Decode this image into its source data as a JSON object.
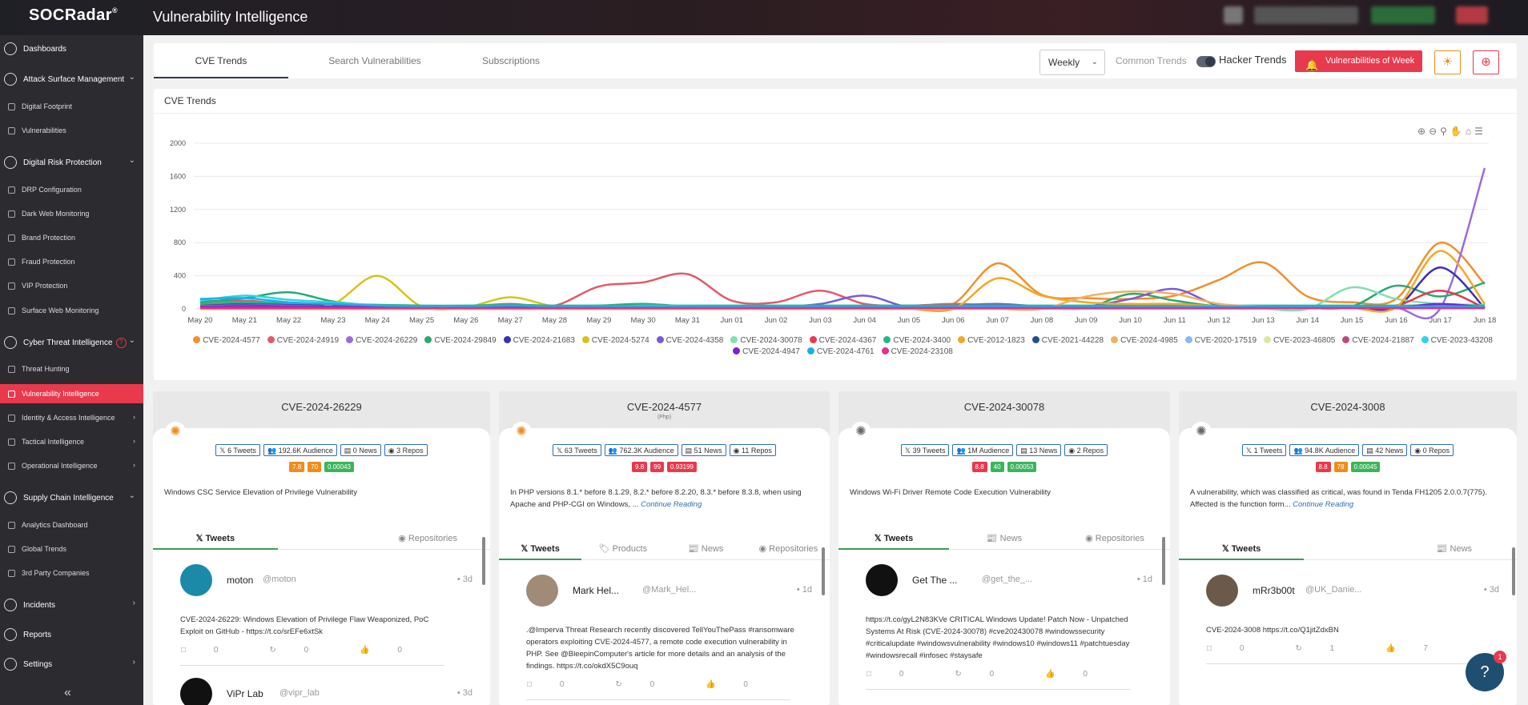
{
  "app": {
    "logo": "SOCRadar",
    "logo_mark": "®",
    "title": "Vulnerability Intelligence"
  },
  "sidebar": {
    "sections": [
      {
        "label": "Dashboards"
      },
      {
        "label": "Attack Surface Management"
      },
      {
        "label": "Digital Risk Protection"
      },
      {
        "label": "Cyber Threat Intelligence"
      },
      {
        "label": "Supply Chain Intelligence"
      },
      {
        "label": "Incidents"
      },
      {
        "label": "Reports"
      },
      {
        "label": "Settings"
      }
    ],
    "items": [
      {
        "label": "Digital Footprint"
      },
      {
        "label": "Vulnerabilities"
      },
      {
        "label": "DRP Configuration"
      },
      {
        "label": "Dark Web Monitoring"
      },
      {
        "label": "Brand Protection"
      },
      {
        "label": "Fraud Protection"
      },
      {
        "label": "VIP Protection"
      },
      {
        "label": "Surface Web Monitoring"
      },
      {
        "label": "Threat Hunting"
      },
      {
        "label": "Vulnerability Intelligence"
      },
      {
        "label": "Identity & Access Intelligence"
      },
      {
        "label": "Tactical Intelligence"
      },
      {
        "label": "Operational Intelligence"
      },
      {
        "label": "Analytics Dashboard"
      },
      {
        "label": "Global Trends"
      },
      {
        "label": "3rd Party Companies"
      }
    ],
    "cti_badge": "?"
  },
  "tabs": [
    {
      "label": "CVE Trends"
    },
    {
      "label": "Search Vulnerabilities"
    },
    {
      "label": "Subscriptions"
    }
  ],
  "controls": {
    "period": "Weekly",
    "common_trends": "Common Trends",
    "hacker_trends": "Hacker Trends",
    "vuln_week": "Vulnerabilities of Week"
  },
  "chart_data": {
    "type": "line",
    "title": "CVE Trends",
    "x": [
      "May 20",
      "May 21",
      "May 22",
      "May 23",
      "May 24",
      "May 25",
      "May 26",
      "May 27",
      "May 28",
      "May 29",
      "May 30",
      "May 31",
      "Jun 01",
      "Jun 02",
      "Jun 03",
      "Jun 04",
      "Jun 05",
      "Jun 06",
      "Jun 07",
      "Jun 08",
      "Jun 09",
      "Jun 10",
      "Jun 11",
      "Jun 12",
      "Jun 13",
      "Jun 14",
      "Jun 15",
      "Jun 16",
      "Jun 17",
      "Jun 18"
    ],
    "ylim": [
      0,
      2000
    ],
    "yticks": [
      0,
      400,
      800,
      1200,
      1600,
      2000
    ],
    "grid": true,
    "legend": "bottom",
    "series": [
      {
        "name": "CVE-2024-4577",
        "color": "#f28e2b",
        "values": [
          60,
          90,
          40,
          30,
          20,
          10,
          10,
          20,
          10,
          10,
          30,
          20,
          30,
          20,
          10,
          20,
          10,
          60,
          550,
          170,
          130,
          120,
          160,
          350,
          560,
          150,
          80,
          120,
          800,
          300
        ]
      },
      {
        "name": "CVE-2024-24919",
        "color": "#e15a6b",
        "values": [
          90,
          100,
          60,
          50,
          30,
          20,
          30,
          60,
          40,
          270,
          320,
          420,
          100,
          80,
          220,
          60,
          40,
          60,
          40,
          20,
          10,
          30,
          60,
          30,
          10,
          10,
          10,
          10,
          10,
          10
        ]
      },
      {
        "name": "CVE-2024-26229",
        "color": "#9b6be0",
        "values": [
          20,
          20,
          20,
          20,
          10,
          10,
          10,
          10,
          10,
          10,
          10,
          10,
          10,
          10,
          10,
          10,
          10,
          10,
          10,
          10,
          10,
          10,
          10,
          10,
          10,
          10,
          10,
          10,
          10,
          1700
        ]
      },
      {
        "name": "CVE-2024-29849",
        "color": "#2aa876",
        "values": [
          80,
          130,
          200,
          90,
          40,
          20,
          30,
          50,
          30,
          40,
          60,
          30,
          20,
          20,
          10,
          20,
          10,
          20,
          20,
          10,
          10,
          180,
          100,
          30,
          20,
          10,
          30,
          280,
          150,
          320
        ]
      },
      {
        "name": "CVE-2024-21683",
        "color": "#3b2fb5",
        "values": [
          40,
          60,
          50,
          40,
          30,
          20,
          20,
          30,
          20,
          20,
          20,
          20,
          20,
          20,
          20,
          20,
          20,
          20,
          20,
          20,
          20,
          20,
          20,
          20,
          20,
          20,
          20,
          20,
          500,
          10
        ]
      },
      {
        "name": "CVE-2024-5274",
        "color": "#d6c318",
        "values": [
          30,
          40,
          30,
          60,
          400,
          30,
          20,
          140,
          30,
          20,
          20,
          20,
          20,
          20,
          20,
          20,
          20,
          20,
          20,
          20,
          20,
          20,
          20,
          20,
          20,
          20,
          20,
          20,
          20,
          20
        ]
      },
      {
        "name": "CVE-2024-4358",
        "color": "#7a5bd6",
        "values": [
          30,
          50,
          40,
          30,
          20,
          20,
          20,
          20,
          20,
          20,
          20,
          20,
          20,
          20,
          60,
          160,
          20,
          40,
          60,
          30,
          30,
          120,
          240,
          40,
          30,
          20,
          20,
          20,
          20,
          20
        ]
      },
      {
        "name": "CVE-2024-30078",
        "color": "#7fe0b0",
        "values": [
          0,
          0,
          0,
          0,
          0,
          0,
          0,
          0,
          0,
          0,
          0,
          0,
          0,
          0,
          0,
          0,
          0,
          0,
          0,
          0,
          0,
          0,
          0,
          0,
          0,
          0,
          260,
          120,
          60,
          50
        ]
      },
      {
        "name": "CVE-2024-4367",
        "color": "#e8394d",
        "values": [
          20,
          20,
          20,
          20,
          20,
          20,
          20,
          20,
          20,
          20,
          20,
          20,
          20,
          20,
          20,
          20,
          20,
          20,
          20,
          20,
          20,
          20,
          20,
          20,
          20,
          20,
          20,
          40,
          220,
          10
        ]
      },
      {
        "name": "CVE-2024-3400",
        "color": "#1fb889",
        "values": [
          60,
          80,
          70,
          60,
          50,
          40,
          40,
          50,
          40,
          40,
          40,
          40,
          40,
          40,
          40,
          40,
          40,
          40,
          40,
          40,
          40,
          40,
          40,
          40,
          40,
          40,
          40,
          40,
          40,
          40
        ]
      },
      {
        "name": "CVE-2012-1823",
        "color": "#f5a623",
        "values": [
          0,
          0,
          0,
          0,
          0,
          0,
          0,
          0,
          0,
          0,
          0,
          0,
          0,
          0,
          0,
          0,
          0,
          0,
          370,
          160,
          80,
          60,
          60,
          30,
          20,
          10,
          10,
          20,
          700,
          60
        ]
      },
      {
        "name": "CVE-2021-44228",
        "color": "#1d4f91",
        "values": [
          30,
          40,
          30,
          30,
          20,
          20,
          20,
          20,
          20,
          20,
          20,
          20,
          20,
          20,
          20,
          20,
          20,
          20,
          20,
          20,
          20,
          20,
          20,
          20,
          20,
          20,
          20,
          20,
          20,
          20
        ]
      },
      {
        "name": "CVE-2024-4985",
        "color": "#f0b063",
        "values": [
          0,
          0,
          0,
          0,
          0,
          0,
          0,
          0,
          0,
          0,
          0,
          0,
          0,
          0,
          0,
          0,
          0,
          0,
          0,
          0,
          150,
          210,
          180,
          60,
          30,
          20,
          10,
          10,
          10,
          10
        ]
      },
      {
        "name": "CVE-2020-17519",
        "color": "#8ab8f0",
        "values": [
          20,
          30,
          20,
          20,
          20,
          20,
          20,
          20,
          20,
          20,
          20,
          20,
          20,
          20,
          20,
          20,
          20,
          20,
          20,
          20,
          20,
          20,
          20,
          20,
          20,
          20,
          20,
          20,
          20,
          20
        ]
      },
      {
        "name": "CVE-2023-46805",
        "color": "#d9e8a0",
        "values": [
          20,
          20,
          20,
          20,
          20,
          20,
          20,
          20,
          20,
          20,
          20,
          20,
          20,
          20,
          20,
          20,
          20,
          20,
          20,
          20,
          20,
          20,
          20,
          20,
          20,
          20,
          20,
          20,
          20,
          20
        ]
      },
      {
        "name": "CVE-2024-21887",
        "color": "#c2477f",
        "values": [
          40,
          30,
          30,
          30,
          20,
          20,
          20,
          20,
          20,
          20,
          20,
          20,
          20,
          20,
          20,
          20,
          20,
          20,
          20,
          20,
          20,
          20,
          20,
          20,
          20,
          20,
          20,
          20,
          20,
          20
        ]
      },
      {
        "name": "CVE-2023-43208",
        "color": "#2ed3e6",
        "values": [
          100,
          160,
          110,
          80,
          40,
          20,
          20,
          30,
          20,
          20,
          40,
          30,
          20,
          20,
          20,
          20,
          20,
          20,
          20,
          20,
          20,
          20,
          20,
          20,
          20,
          20,
          20,
          20,
          20,
          20
        ]
      },
      {
        "name": "CVE-2024-4947",
        "color": "#7b22d6",
        "values": [
          20,
          20,
          20,
          20,
          20,
          20,
          20,
          20,
          20,
          20,
          20,
          20,
          20,
          20,
          20,
          20,
          20,
          20,
          20,
          20,
          20,
          20,
          20,
          20,
          20,
          20,
          20,
          20,
          60,
          20
        ]
      },
      {
        "name": "CVE-2024-4761",
        "color": "#1ab0e8",
        "values": [
          120,
          130,
          80,
          60,
          40,
          30,
          30,
          40,
          30,
          30,
          30,
          30,
          30,
          30,
          30,
          30,
          30,
          30,
          30,
          30,
          30,
          30,
          30,
          30,
          30,
          30,
          30,
          30,
          30,
          30
        ]
      },
      {
        "name": "CVE-2024-23108",
        "color": "#e82d8a",
        "values": [
          10,
          10,
          10,
          10,
          10,
          10,
          10,
          10,
          10,
          10,
          10,
          10,
          10,
          10,
          10,
          10,
          10,
          10,
          10,
          10,
          10,
          10,
          10,
          10,
          10,
          10,
          10,
          10,
          10,
          10
        ]
      }
    ]
  },
  "cards": [
    {
      "cve": "CVE-2024-26229",
      "sub": "",
      "icon": "bug-orange-icon",
      "stats": [
        "6 Tweets",
        "192.6K Audience",
        "0 News",
        "3 Repos"
      ],
      "scores": [
        {
          "v": "7.8",
          "c": "#f08c1a"
        },
        {
          "v": "70",
          "c": "#f08c1a"
        },
        {
          "v": "0.00043",
          "c": "#3bb55a"
        }
      ],
      "desc": "Windows CSC Service Elevation of Privilege Vulnerability",
      "more": "",
      "tabs": [
        "Tweets",
        "Repositories"
      ],
      "tweets": [
        {
          "name": "moton",
          "handle": "@moton",
          "time": "3d",
          "text": "CVE-2024-26229: Windows Elevation of Privilege Flaw Weaponized, PoC Exploit on GitHub - https://t.co/srEFe6xtSk",
          "replies": "0",
          "retweets": "0",
          "likes": "0",
          "avatar": "#1a8aa8"
        },
        {
          "name": "ViPr Lab",
          "handle": "@vipr_lab",
          "time": "3d",
          "text": "",
          "avatar": "#111"
        }
      ]
    },
    {
      "cve": "CVE-2024-4577",
      "sub": "(Php)",
      "icon": "bug-orange-icon",
      "stats": [
        "63 Tweets",
        "762.3K Audience",
        "51 News",
        "11 Repos"
      ],
      "scores": [
        {
          "v": "9.8",
          "c": "#e8394d"
        },
        {
          "v": "99",
          "c": "#e8394d"
        },
        {
          "v": "0.93199",
          "c": "#e8394d"
        }
      ],
      "desc": "In PHP versions 8.1.* before 8.1.29, 8.2.* before 8.2.20, 8.3.* before 8.3.8, when using Apache and PHP-CGI on Windows, ...",
      "more": "Continue Reading",
      "tabs": [
        "Tweets",
        "Products",
        "News",
        "Repositories"
      ],
      "tweets": [
        {
          "name": "Mark Hel...",
          "handle": "@Mark_Hel...",
          "time": "1d",
          "text": ".@Imperva Threat Research recently discovered TellYouThePass #ransomware operators exploiting CVE-2024-4577, a remote code execution vulnerability in PHP. See @BleepinComputer's article for more details and an analysis of the findings. https://t.co/okdX5C9ouq",
          "replies": "0",
          "retweets": "0",
          "likes": "0",
          "avatar": "#a08a78"
        }
      ]
    },
    {
      "cve": "CVE-2024-30078",
      "sub": "",
      "icon": "bug-grey-icon",
      "stats": [
        "39 Tweets",
        "1M Audience",
        "13 News",
        "2 Repos"
      ],
      "scores": [
        {
          "v": "8.8",
          "c": "#e8394d"
        },
        {
          "v": "40",
          "c": "#3bb55a"
        },
        {
          "v": "0.00053",
          "c": "#3bb55a"
        }
      ],
      "desc": "Windows Wi-Fi Driver Remote Code Execution Vulnerability",
      "more": "",
      "tabs": [
        "Tweets",
        "News",
        "Repositories"
      ],
      "tweets": [
        {
          "name": "Get The ...",
          "handle": "@get_the_...",
          "time": "1d",
          "text": "https://t.co/gyL2N83KVe CRITICAL Windows Update! Patch Now - Unpatched Systems At Risk (CVE-2024-30078) #cve202430078 #windowssecurity #criticalupdate #windowsvulnerability #windows10 #windows11 #patchtuesday #windowsrecall #infosec #staysafe",
          "replies": "0",
          "retweets": "0",
          "likes": "0",
          "avatar": "#111"
        }
      ]
    },
    {
      "cve": "CVE-2024-3008",
      "sub": "",
      "icon": "bug-grey-icon",
      "stats": [
        "1 Tweets",
        "94.8K Audience",
        "42 News",
        "0 Repos"
      ],
      "scores": [
        {
          "v": "8.8",
          "c": "#e8394d"
        },
        {
          "v": "78",
          "c": "#f08c1a"
        },
        {
          "v": "0.00045",
          "c": "#3bb55a"
        }
      ],
      "desc": "A vulnerability, which was classified as critical, was found in Tenda FH1205 2.0.0.7(775). Affected is the function form...",
      "more": "Continue Reading",
      "tabs": [
        "Tweets",
        "News"
      ],
      "tweets": [
        {
          "name": "mRr3b00t",
          "handle": "@UK_Danie...",
          "time": "3d",
          "text": "CVE-2024-3008 https://t.co/Q1jitZdxBN",
          "replies": "0",
          "retweets": "1",
          "likes": "7",
          "avatar": "#6b5a4a"
        }
      ]
    }
  ],
  "help": {
    "count": "1"
  }
}
